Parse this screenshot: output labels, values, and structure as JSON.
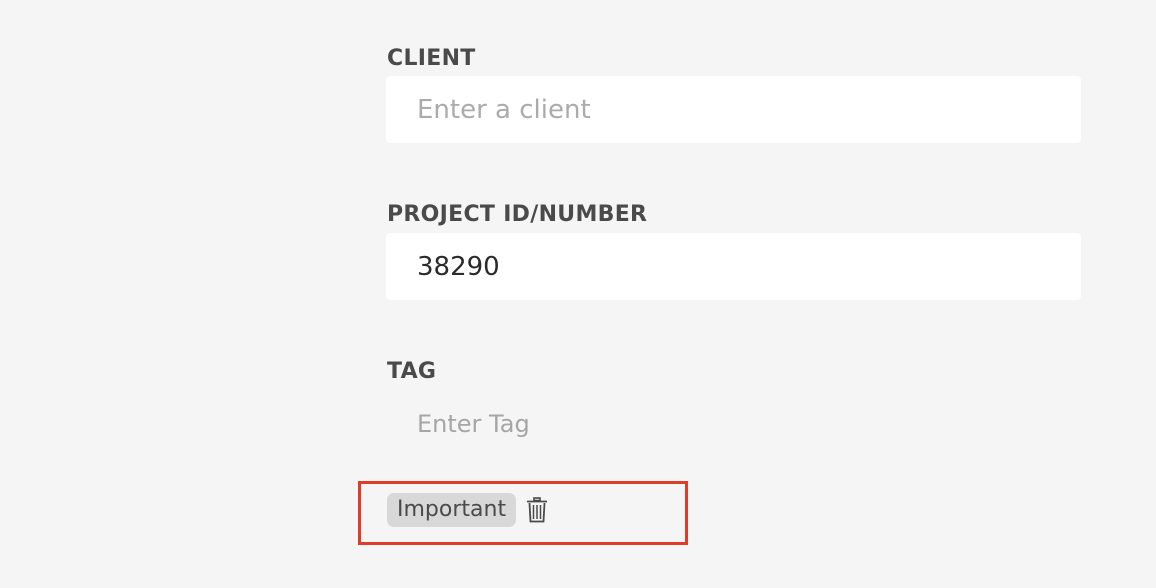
{
  "client": {
    "label": "CLIENT",
    "placeholder": "Enter a client",
    "value": ""
  },
  "project": {
    "label": "PROJECT ID/NUMBER",
    "placeholder": "",
    "value": "38290"
  },
  "tag": {
    "label": "TAG",
    "placeholder": "Enter Tag",
    "value": ""
  },
  "tags": [
    {
      "label": "Important",
      "delete_icon": "trash-icon"
    }
  ],
  "colors": {
    "background": "#f5f5f5",
    "input_background": "#ffffff",
    "label": "#4a4a4a",
    "chip_background": "#d8d8d8",
    "highlight": "#e03c2a"
  }
}
